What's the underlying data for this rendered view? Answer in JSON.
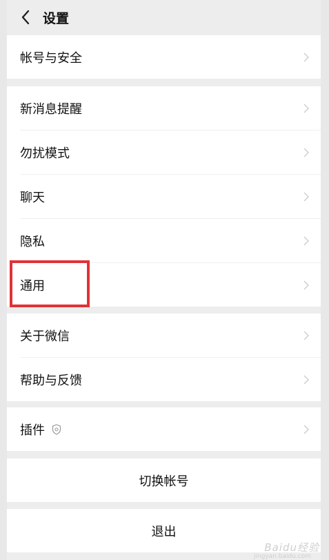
{
  "header": {
    "title": "设置"
  },
  "groups": {
    "account": [
      {
        "label": "帐号与安全"
      }
    ],
    "settings": [
      {
        "label": "新消息提醒"
      },
      {
        "label": "勿扰模式"
      },
      {
        "label": "聊天"
      },
      {
        "label": "隐私"
      },
      {
        "label": "通用"
      }
    ],
    "about": [
      {
        "label": "关于微信"
      },
      {
        "label": "帮助与反馈"
      }
    ],
    "plugins": [
      {
        "label": "插件"
      }
    ]
  },
  "actions": {
    "switch_account": "切换帐号",
    "logout": "退出"
  },
  "watermark": {
    "text": "Baidu经验",
    "sub": "jingyan.baidu.com"
  },
  "colors": {
    "highlight": "#e03237",
    "background": "#ededed",
    "card": "#ffffff"
  }
}
